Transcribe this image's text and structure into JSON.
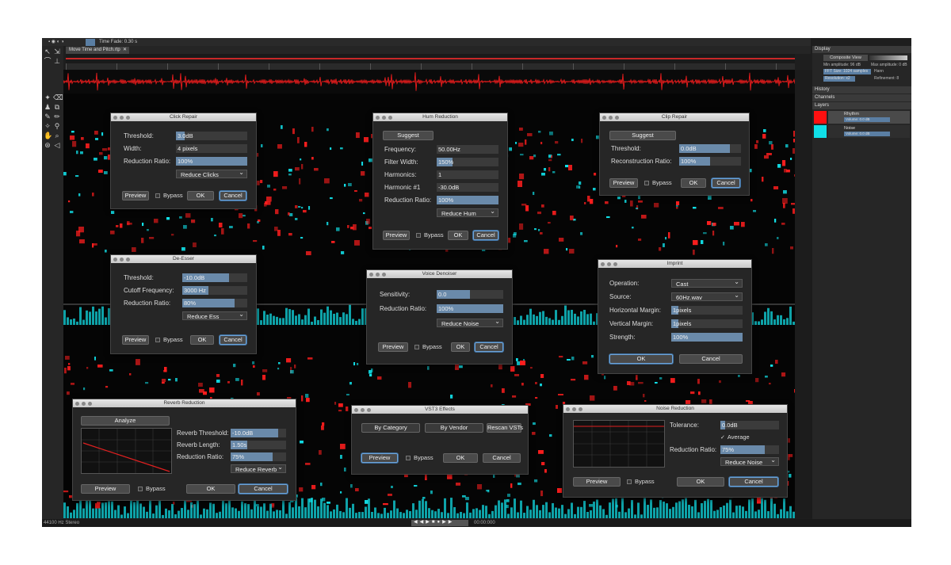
{
  "app": {
    "topbar": {
      "time_label": "Time Fade: 0.30 s"
    },
    "file_tab": "Move Time and Pitch.rtp",
    "status": {
      "format": "44100 Hz Stereo",
      "transport_time": "00:00:000"
    }
  },
  "right_panel": {
    "display": "Display",
    "composite_view": "Composite View",
    "min_amplitude": "Min amplitude: 96 dB",
    "max_amplitude": "Max amplitude: 0 dB",
    "fft": "FFT Size: 1024 samples",
    "window": "Hann",
    "resolution": "Resolution: x2",
    "refinement": "Refinement: 8",
    "history": "History",
    "channels": "Channels",
    "layers": "Layers",
    "layer1": "Rhythm",
    "layer1_vol": "Volume: 0.0 dB",
    "layer2": "Noise",
    "layer2_vol": "Volume: 0.0 dB"
  },
  "colors": {
    "spectro_red": "#ff1e1e",
    "spectro_cyan": "#12e6ee",
    "layer_red": "#ff1010",
    "layer_cyan": "#10e0e8"
  },
  "dialogs": {
    "click_repair": {
      "title": "Click Repair",
      "threshold_label": "Threshold:",
      "threshold_value": "3.0dB",
      "threshold_level": 0.12,
      "width_label": "Width:",
      "width_value": "4 pixels",
      "ratio_label": "Reduction Ratio:",
      "ratio_value": "100%",
      "ratio_level": 1.0,
      "mode": "Reduce Clicks",
      "preview": "Preview",
      "bypass": "Bypass",
      "ok": "OK",
      "cancel": "Cancel"
    },
    "hum_reduction": {
      "title": "Hum Reduction",
      "suggest": "Suggest",
      "freq_label": "Frequency:",
      "freq_value": "50.00Hz",
      "fw_label": "Filter Width:",
      "fw_value": "150%",
      "fw_level": 0.25,
      "harm_label": "Harmonics:",
      "harm_value": "1",
      "h1_label": "Harmonic #1",
      "h1_value": "-30.0dB",
      "ratio_label": "Reduction Ratio:",
      "ratio_value": "100%",
      "ratio_level": 1.0,
      "mode": "Reduce Hum",
      "preview": "Preview",
      "bypass": "Bypass",
      "ok": "OK",
      "cancel": "Cancel"
    },
    "clip_repair": {
      "title": "Clip Repair",
      "suggest": "Suggest",
      "threshold_label": "Threshold:",
      "threshold_value": "0.0dB",
      "threshold_level": 0.82,
      "recon_label": "Reconstruction Ratio:",
      "recon_value": "100%",
      "recon_level": 0.5,
      "preview": "Preview",
      "bypass": "Bypass",
      "ok": "OK",
      "cancel": "Cancel"
    },
    "de_esser": {
      "title": "De-Esser",
      "threshold_label": "Threshold:",
      "threshold_value": "-10.0dB",
      "threshold_level": 0.72,
      "cutoff_label": "Cutoff Frequency:",
      "cutoff_value": "3000 Hz",
      "cutoff_level": 0.4,
      "ratio_label": "Reduction Ratio:",
      "ratio_value": "80%",
      "ratio_level": 0.8,
      "mode": "Reduce Ess",
      "preview": "Preview",
      "bypass": "Bypass",
      "ok": "OK",
      "cancel": "Cancel"
    },
    "voice_denoiser": {
      "title": "Voice Denoiser",
      "sens_label": "Sensitivity:",
      "sens_value": "0.0",
      "sens_level": 0.5,
      "ratio_label": "Reduction Ratio:",
      "ratio_value": "100%",
      "ratio_level": 1.0,
      "mode": "Reduce Noise",
      "preview": "Preview",
      "bypass": "Bypass",
      "ok": "OK",
      "cancel": "Cancel"
    },
    "imprint": {
      "title": "Imprint",
      "op_label": "Operation:",
      "op_value": "Cast",
      "src_label": "Source:",
      "src_value": "60Hz.wav",
      "hm_label": "Horizontal Margin:",
      "hm_value": "1pixels",
      "hm_level": 0.1,
      "vm_label": "Vertical Margin:",
      "vm_value": "1pixels",
      "vm_level": 0.1,
      "str_label": "Strength:",
      "str_value": "100%",
      "str_level": 1.0,
      "ok": "OK",
      "cancel": "Cancel"
    },
    "reverb_reduction": {
      "title": "Reverb Reduction",
      "analyze": "Analyze",
      "rt_label": "Reverb Threshold:",
      "rt_value": "-10.0dB",
      "rt_level": 0.85,
      "rl_label": "Reverb Length:",
      "rl_value": "1.50s",
      "rl_level": 0.3,
      "ratio_label": "Reduction Ratio:",
      "ratio_value": "75%",
      "ratio_level": 0.75,
      "mode": "Reduce Reverb",
      "preview": "Preview",
      "bypass": "Bypass",
      "ok": "OK",
      "cancel": "Cancel"
    },
    "vst3": {
      "title": "VST3 Effects",
      "by_category": "By Category",
      "by_vendor": "By Vendor",
      "rescan": "Rescan VSTs",
      "preview": "Preview",
      "bypass": "Bypass",
      "ok": "OK",
      "cancel": "Cancel"
    },
    "noise_reduction": {
      "title": "Noise Reduction",
      "tol_label": "Tolerance:",
      "tol_value": "0.0dB",
      "tol_level": 0.08,
      "average": "Average",
      "ratio_label": "Reduction Ratio:",
      "ratio_value": "75%",
      "ratio_level": 0.75,
      "mode": "Reduce Noise",
      "preview": "Preview",
      "bypass": "Bypass",
      "ok": "OK",
      "cancel": "Cancel"
    }
  }
}
